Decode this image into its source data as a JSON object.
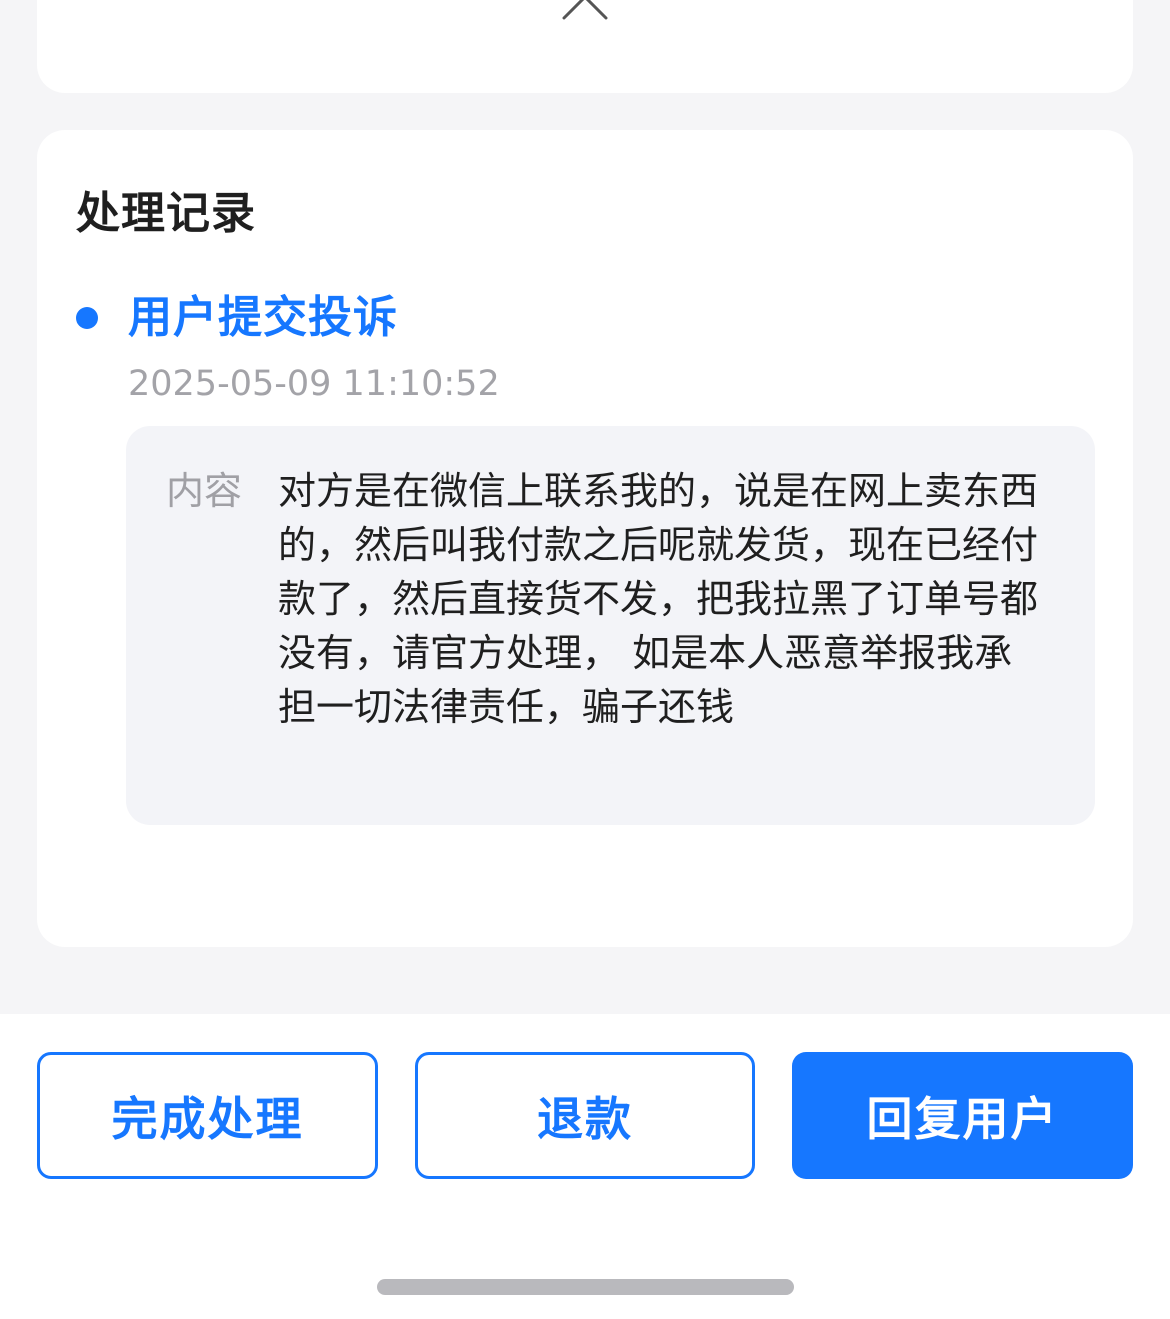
{
  "collapse_icon": "chevron-up-icon",
  "record": {
    "title": "处理记录",
    "event": {
      "title": "用户提交投诉",
      "time": "2025-05-09 11:10:52",
      "content_label": "内容",
      "content_text": "对方是在微信上联系我的，说是在网上卖东西的，然后叫我付款之后呢就发货，现在已经付款了，然后直接货不发，把我拉黑了订单号都没有，请官方处理， 如是本人恶意举报我承担一切法律责任，骗子还钱"
    }
  },
  "actions": {
    "complete_label": "完成处理",
    "refund_label": "退款",
    "reply_label": "回复用户"
  },
  "colors": {
    "accent": "#1677ff",
    "page_bg": "#f5f5f7",
    "content_bg": "#f3f4f8"
  }
}
